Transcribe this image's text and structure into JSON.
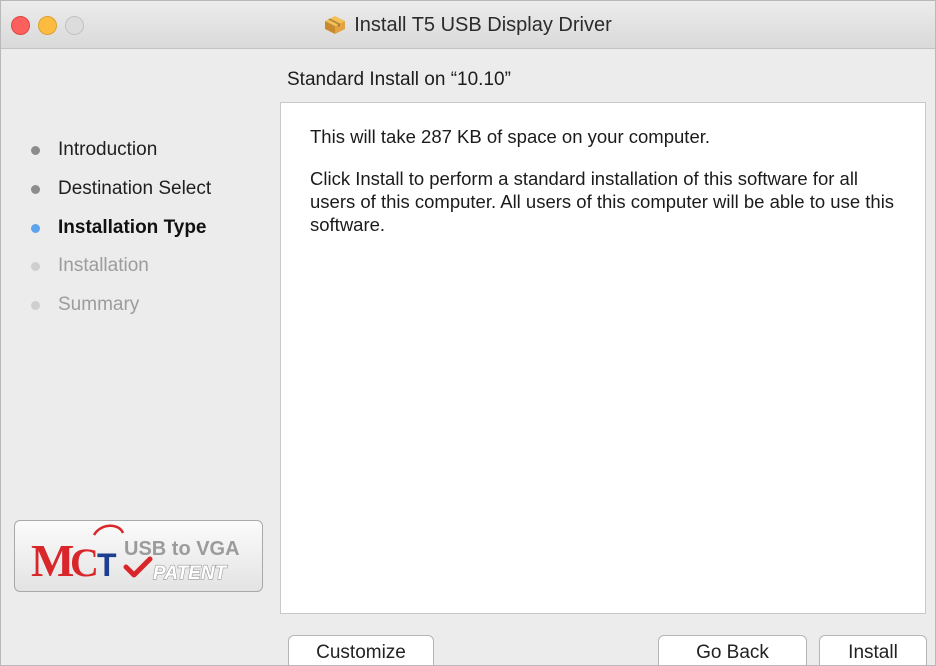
{
  "window": {
    "title": "Install T5 USB Display Driver"
  },
  "sidebar": {
    "steps": [
      {
        "label": "Introduction",
        "state": "done"
      },
      {
        "label": "Destination Select",
        "state": "done"
      },
      {
        "label": "Installation Type",
        "state": "current"
      },
      {
        "label": "Installation",
        "state": "pending"
      },
      {
        "label": "Summary",
        "state": "pending"
      }
    ],
    "logo": {
      "brand": "MCT",
      "line1": "USB to VGA",
      "line2": "PATENT"
    }
  },
  "main": {
    "heading": "Standard Install on “10.10”",
    "paragraph1": "This will take 287 KB of space on your computer.",
    "paragraph2": "Click Install to perform a standard installation of this software for all users of this computer. All users of this computer will be able to use this software."
  },
  "buttons": {
    "customize": "Customize",
    "go_back": "Go Back",
    "install": "Install"
  },
  "colors": {
    "active_step_dot": "#5ea3ef",
    "close": "#fc605c",
    "minimize": "#fdbc40",
    "logo_red": "#d8262b"
  }
}
